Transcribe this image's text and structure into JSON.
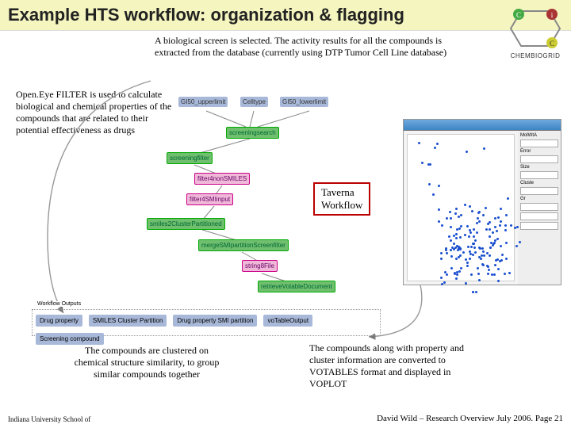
{
  "title": "Example HTS workflow: organization & flagging",
  "logo_label": "CHEMBIOGRID",
  "intro_text": "A biological screen is selected. The activity results for all the compounds is extracted from the database (currently using DTP Tumor Cell Line database)",
  "openeye_text": "Open.Eye FILTER is used to calculate biological and chemical properties of the compounds that are related to their potential effectiveness as drugs",
  "taverna_label_l1": "Taverna",
  "taverna_label_l2": "Workflow",
  "bottom_left_text": "The compounds are clustered on chemical structure similarity, to group similar compounds together",
  "bottom_right_text": "The compounds along with property and cluster information are converted to VOTABLES format and displayed in VOPLOT",
  "footer_left": "Indiana University School of",
  "footer_right": "David Wild – Research Overview July 2006. Page 21",
  "workflow": {
    "inputs": [
      "GI50_upperlimit",
      "Celltype",
      "GI50_lowerlimit"
    ],
    "nodes": {
      "screeningsearch": "screeningsearch",
      "screeningfilter": "screeningfilter",
      "filter4nonSMILES": "filter4nonSMILES",
      "filter4SMIinput": "filter4SMIinput",
      "smiles2ClusterPartitioned": "smiles2ClusterPartitioned",
      "mergeSMIpartitionScreenfilter": "mergeSMIpartitionScreenfilter",
      "string8File": "string8File",
      "retrieveVotableDocument": "retrieveVotableDocument"
    },
    "outputs_label": "Workflow Outputs",
    "outputs": [
      "Drug property",
      "SMILES Cluster Partition",
      "Drug property SMI partition",
      "voTableOutput",
      "Screening compound"
    ]
  },
  "scatter": {
    "side_labels": [
      "MolWtA",
      "Error",
      "Size",
      "Cluste",
      "Gr"
    ]
  }
}
